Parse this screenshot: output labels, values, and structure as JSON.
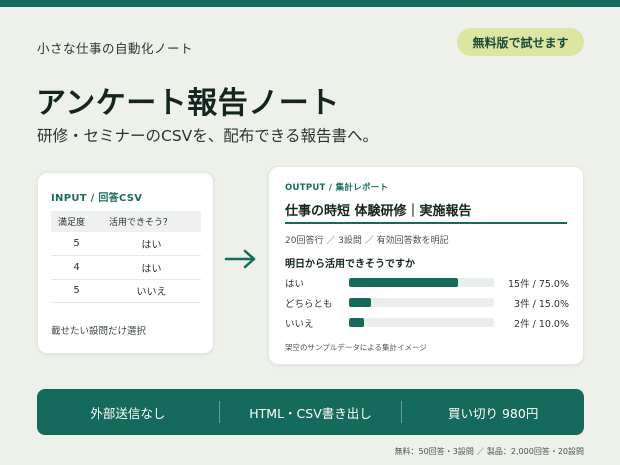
{
  "header": {
    "series": "小さな仕事の自動化ノート",
    "badge": "無料版で試せます",
    "title": "アンケート報告ノート",
    "subtitle": "研修・セミナーのCSVを、配布できる報告書へ。"
  },
  "input_card": {
    "label": "INPUT / 回答CSV",
    "columns": [
      "満足度",
      "活用できそう？"
    ],
    "rows": [
      [
        "5",
        "はい"
      ],
      [
        "4",
        "はい"
      ],
      [
        "5",
        "いいえ"
      ]
    ],
    "note": "載せたい設問だけ選択"
  },
  "output_card": {
    "label": "OUTPUT / 集計レポート",
    "title": "仕事の時短 体験研修｜実施報告",
    "meta": "20回答行 ／ 3設問 ／ 有効回答数を明記",
    "question": "明日から活用できそうですか",
    "results": [
      {
        "label": "はい",
        "value": "15件 / 75.0%",
        "fraction": 0.75
      },
      {
        "label": "どちらとも",
        "value": "3件 / 15.0%",
        "fraction": 0.15
      },
      {
        "label": "いいえ",
        "value": "2件 / 10.0%",
        "fraction": 0.1
      }
    ],
    "footnote": "架空のサンプルデータによる集計イメージ"
  },
  "banner": {
    "items": [
      "外部送信なし",
      "HTML・CSV書き出し",
      "買い切り 980円"
    ]
  },
  "footnote": "無料：50回答・3設問 ／ 製品：2,000回答・20設問",
  "colors": {
    "accent": "#156b5b",
    "badge": "#dce5a2",
    "background": "#edf1ea"
  }
}
